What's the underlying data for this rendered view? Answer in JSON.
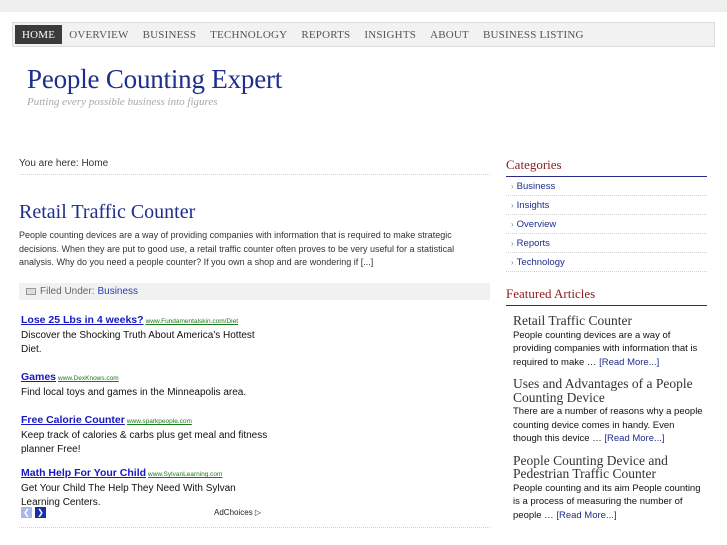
{
  "nav": {
    "items": [
      "HOME",
      "OVERVIEW",
      "BUSINESS",
      "TECHNOLOGY",
      "REPORTS",
      "INSIGHTS",
      "ABOUT",
      "BUSINESS LISTING"
    ],
    "active": "HOME"
  },
  "site": {
    "title": "People Counting Expert",
    "description": "Putting every possible business into figures"
  },
  "breadcrumb": "You are here: Home",
  "post": {
    "title": "Retail Traffic Counter",
    "excerpt": "People counting devices are a way of providing companies with information that is required to make strategic decisions. When they are put to good use, a retail traffic counter often proves to be very useful for a statistical analysis. Why do you need a people counter? If you own a shop and are wondering if [...]",
    "filed_label": "Filed Under:",
    "category": "Business"
  },
  "ads": [
    {
      "headline": "Lose 25 Lbs in 4 weeks?",
      "url": "www.Fundamentalskin.com/Diet",
      "body": "Discover the Shocking Truth About America's Hottest Diet."
    },
    {
      "headline": "Games",
      "url": "www.DexKnows.com",
      "body": "Find local toys and games in the Minneapolis area."
    },
    {
      "headline": "Free Calorie Counter",
      "url": "www.sparkpeople.com",
      "body": "Keep track of calories & carbs plus get meal and fitness planner Free!"
    },
    {
      "headline": "Math Help For Your Child",
      "url": "www.SylvanLearning.com",
      "body": "Get Your Child The Help They Need With Sylvan Learning Centers."
    }
  ],
  "adchoices": "AdChoices",
  "sidebar": {
    "categories_title": "Categories",
    "categories": [
      "Business",
      "Insights",
      "Overview",
      "Reports",
      "Technology"
    ],
    "featured_title": "Featured Articles",
    "featured": [
      {
        "title": "Retail Traffic Counter",
        "text": "People counting devices are a way of providing companies with information that is required to make …",
        "more": "[Read More...]"
      },
      {
        "title": "Uses and Advantages of a People Counting Device",
        "text": "There are a number of reasons why a people counting device comes in handy. Even though this device …",
        "more": "[Read More...]"
      },
      {
        "title": "People Counting Device and Pedestrian Traffic Counter",
        "text": "People counting and its aim People counting is a process of measuring the number of people …",
        "more": "[Read More...]"
      }
    ]
  }
}
